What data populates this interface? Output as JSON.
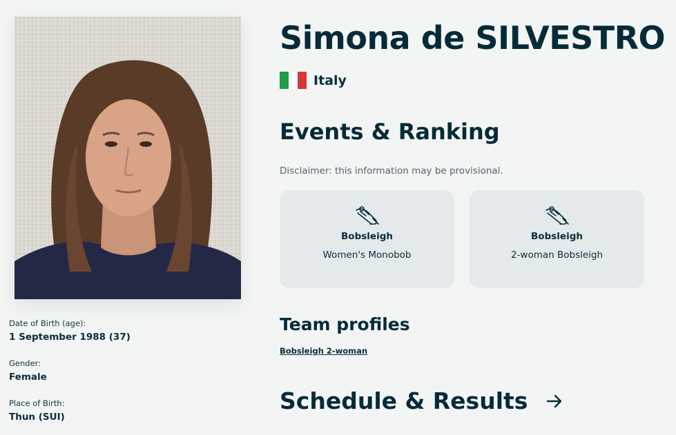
{
  "athlete": {
    "name": "Simona de SILVESTRO",
    "country": "Italy",
    "flag_colors": [
      "#1e9e4a",
      "#ffffff",
      "#d8343a"
    ]
  },
  "bio": {
    "dob_label": "Date of Birth (age):",
    "dob_value": "1 September 1988 (37)",
    "gender_label": "Gender:",
    "gender_value": "Female",
    "pob_label": "Place of Birth:",
    "pob_value": "Thun (SUI)"
  },
  "events_section": {
    "title": "Events & Ranking",
    "disclaimer": "Disclaimer: this information may be provisional.",
    "cards": [
      {
        "icon": "bobsleigh-icon",
        "sport": "Bobsleigh",
        "event": "Women's Monobob"
      },
      {
        "icon": "bobsleigh-icon",
        "sport": "Bobsleigh",
        "event": "2-woman Bobsleigh"
      }
    ]
  },
  "team_section": {
    "title": "Team profiles",
    "link": "Bobsleigh 2-woman"
  },
  "schedule_section": {
    "title": "Schedule & Results",
    "icon": "arrow-right-icon"
  }
}
